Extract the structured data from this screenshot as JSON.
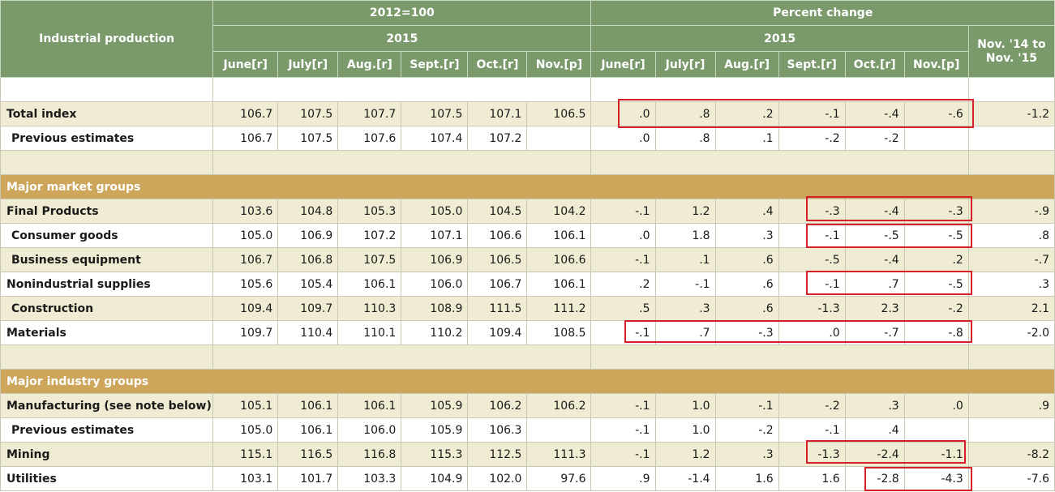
{
  "header": {
    "row_label": "Industrial production",
    "index_group": "2012=100",
    "pct_group": "Percent change",
    "index_year": "2015",
    "pct_year": "2015",
    "yoy_label": "Nov. '14 to Nov. '15",
    "index_months": [
      "June[r]",
      "July[r]",
      "Aug.[r]",
      "Sept.[r]",
      "Oct.[r]",
      "Nov.[p]"
    ],
    "pct_months": [
      "June[r]",
      "July[r]",
      "Aug.[r]",
      "Sept.[r]",
      "Oct.[r]",
      "Nov.[p]"
    ]
  },
  "sections": {
    "major_market": "Major market groups",
    "major_industry": "Major industry groups"
  },
  "rows": [
    {
      "label": "Total index",
      "index": [
        "106.7",
        "107.5",
        "107.7",
        "107.5",
        "107.1",
        "106.5"
      ],
      "pct": [
        ".0",
        ".8",
        ".2",
        "-.1",
        "-.4",
        "-.6"
      ],
      "yoy": "-1.2"
    },
    {
      "label": "Previous estimates",
      "index": [
        "106.7",
        "107.5",
        "107.6",
        "107.4",
        "107.2",
        ""
      ],
      "pct": [
        ".0",
        ".8",
        ".1",
        "-.2",
        "-.2",
        ""
      ],
      "yoy": ""
    },
    {
      "label": "Final Products",
      "index": [
        "103.6",
        "104.8",
        "105.3",
        "105.0",
        "104.5",
        "104.2"
      ],
      "pct": [
        "-.1",
        "1.2",
        ".4",
        "-.3",
        "-.4",
        "-.3"
      ],
      "yoy": "-.9"
    },
    {
      "label": "Consumer goods",
      "index": [
        "105.0",
        "106.9",
        "107.2",
        "107.1",
        "106.6",
        "106.1"
      ],
      "pct": [
        ".0",
        "1.8",
        ".3",
        "-.1",
        "-.5",
        "-.5"
      ],
      "yoy": ".8"
    },
    {
      "label": "Business equipment",
      "index": [
        "106.7",
        "106.8",
        "107.5",
        "106.9",
        "106.5",
        "106.6"
      ],
      "pct": [
        "-.1",
        ".1",
        ".6",
        "-.5",
        "-.4",
        ".2"
      ],
      "yoy": "-.7"
    },
    {
      "label": "Nonindustrial supplies",
      "index": [
        "105.6",
        "105.4",
        "106.1",
        "106.0",
        "106.7",
        "106.1"
      ],
      "pct": [
        ".2",
        "-.1",
        ".6",
        "-.1",
        ".7",
        "-.5"
      ],
      "yoy": ".3"
    },
    {
      "label": "Construction",
      "index": [
        "109.4",
        "109.7",
        "110.3",
        "108.9",
        "111.5",
        "111.2"
      ],
      "pct": [
        ".5",
        ".3",
        ".6",
        "-1.3",
        "2.3",
        "-.2"
      ],
      "yoy": "2.1"
    },
    {
      "label": "Materials",
      "index": [
        "109.7",
        "110.4",
        "110.1",
        "110.2",
        "109.4",
        "108.5"
      ],
      "pct": [
        "-.1",
        ".7",
        "-.3",
        ".0",
        "-.7",
        "-.8"
      ],
      "yoy": "-2.0"
    },
    {
      "label": "Manufacturing (see note below)",
      "index": [
        "105.1",
        "106.1",
        "106.1",
        "105.9",
        "106.2",
        "106.2"
      ],
      "pct": [
        "-.1",
        "1.0",
        "-.1",
        "-.2",
        ".3",
        ".0"
      ],
      "yoy": ".9"
    },
    {
      "label": "Previous estimates",
      "index": [
        "105.0",
        "106.1",
        "106.0",
        "105.9",
        "106.3",
        ""
      ],
      "pct": [
        "-.1",
        "1.0",
        "-.2",
        "-.1",
        ".4",
        ""
      ],
      "yoy": ""
    },
    {
      "label": "Mining",
      "index": [
        "115.1",
        "116.5",
        "116.8",
        "115.3",
        "112.5",
        "111.3"
      ],
      "pct": [
        "-.1",
        "1.2",
        ".3",
        "-1.3",
        "-2.4",
        "-1.1"
      ],
      "yoy": "-8.2"
    },
    {
      "label": "Utilities",
      "index": [
        "103.1",
        "101.7",
        "103.3",
        "104.9",
        "102.0",
        "97.6"
      ],
      "pct": [
        ".9",
        "-1.4",
        "1.6",
        "1.6",
        "-2.8",
        "-4.3"
      ],
      "yoy": "-7.6"
    }
  ],
  "colors": {
    "header_bg": "#7b9a6c",
    "band_bg": "#f0ecd3",
    "section_bg": "#cda55b",
    "highlight_border": "#d42029"
  }
}
